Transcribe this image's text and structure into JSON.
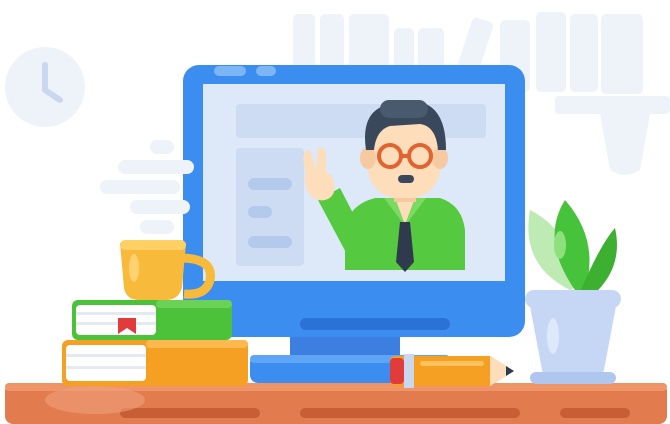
{
  "illustration": {
    "subject": "online-teacher-video-lesson",
    "icons": [
      "clock-icon",
      "bookshelf-icon",
      "monitor-icon",
      "teacher-avatar",
      "coffee-cup-icon",
      "steam-icon",
      "books-icon",
      "pencil-icon",
      "plant-icon",
      "desk-icon"
    ]
  },
  "colors": {
    "desk": "#E27C4F",
    "desk_shadow": "#C85E34",
    "monitor_frame": "#3C8DF0",
    "screen": "#DDE8F8",
    "shirt": "#55C93F",
    "hair": "#39485A",
    "skin": "#FDDDBA",
    "glasses": "#E2632F",
    "cup": "#F7BA3A",
    "book_green": "#4CC13A",
    "book_orange": "#F6A023",
    "pencil": "#F6A023",
    "plant": "#46C33A",
    "pot": "#C5D7F5",
    "background_shapes": "#EEF3FA"
  }
}
